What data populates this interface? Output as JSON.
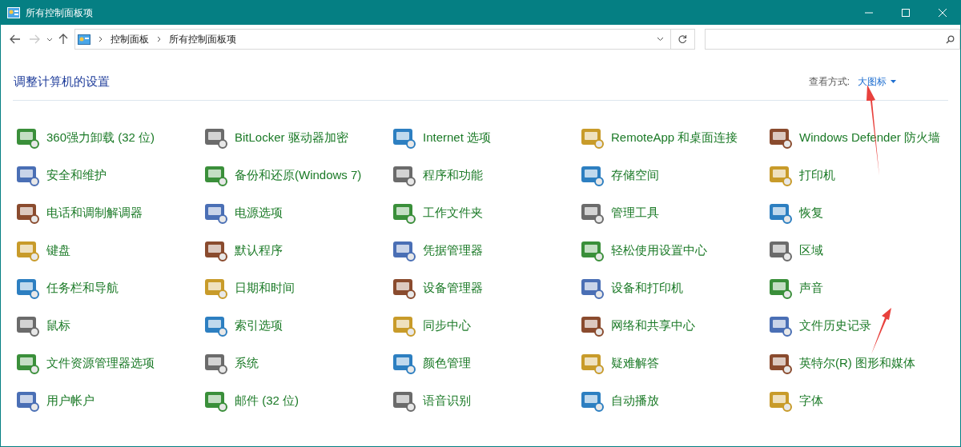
{
  "window": {
    "title": "所有控制面板项"
  },
  "address_bar": {
    "crumbs": [
      "控制面板",
      "所有控制面板项"
    ]
  },
  "header": {
    "title": "调整计算机的设置",
    "view_label": "查看方式:",
    "view_value": "大图标"
  },
  "items": [
    {
      "label": "360强力卸载 (32 位)"
    },
    {
      "label": "BitLocker 驱动器加密"
    },
    {
      "label": "Internet 选项"
    },
    {
      "label": "RemoteApp 和桌面连接"
    },
    {
      "label": "Windows Defender 防火墙"
    },
    {
      "label": "安全和维护"
    },
    {
      "label": "备份和还原(Windows 7)"
    },
    {
      "label": "程序和功能"
    },
    {
      "label": "存储空间"
    },
    {
      "label": "打印机"
    },
    {
      "label": "电话和调制解调器"
    },
    {
      "label": "电源选项"
    },
    {
      "label": "工作文件夹"
    },
    {
      "label": "管理工具"
    },
    {
      "label": "恢复"
    },
    {
      "label": "键盘"
    },
    {
      "label": "默认程序"
    },
    {
      "label": "凭据管理器"
    },
    {
      "label": "轻松使用设置中心"
    },
    {
      "label": "区域"
    },
    {
      "label": "任务栏和导航"
    },
    {
      "label": "日期和时间"
    },
    {
      "label": "设备管理器"
    },
    {
      "label": "设备和打印机"
    },
    {
      "label": "声音"
    },
    {
      "label": "鼠标"
    },
    {
      "label": "索引选项"
    },
    {
      "label": "同步中心"
    },
    {
      "label": "网络和共享中心"
    },
    {
      "label": "文件历史记录"
    },
    {
      "label": "文件资源管理器选项"
    },
    {
      "label": "系统"
    },
    {
      "label": "颜色管理"
    },
    {
      "label": "疑难解答"
    },
    {
      "label": "英特尔(R) 图形和媒体"
    },
    {
      "label": "用户帐户"
    },
    {
      "label": "邮件 (32 位)"
    },
    {
      "label": "语音识别"
    },
    {
      "label": "自动播放"
    },
    {
      "label": "字体"
    }
  ]
}
